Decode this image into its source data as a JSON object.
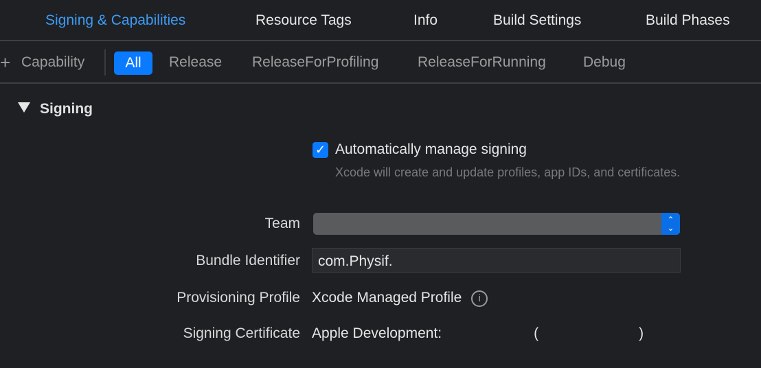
{
  "tabs": [
    "Signing & Capabilities",
    "Resource Tags",
    "Info",
    "Build Settings",
    "Build Phases"
  ],
  "filter": {
    "add_capability": "Capability",
    "configs": [
      "All",
      "Release",
      "ReleaseForProfiling",
      "ReleaseForRunning",
      "Debug"
    ]
  },
  "signing": {
    "title": "Signing",
    "auto_manage_label": "Automatically manage signing",
    "auto_manage_checked": true,
    "auto_manage_hint": "Xcode will create and update profiles, app IDs, and certificates.",
    "team_label": "Team",
    "team_value": "",
    "bundle_label": "Bundle Identifier",
    "bundle_value": "com.Physif.",
    "profile_label": "Provisioning Profile",
    "profile_value": "Xcode Managed Profile",
    "cert_label": "Signing Certificate",
    "cert_value": "Apple Development:",
    "cert_paren_open": "(",
    "cert_paren_close": ")"
  },
  "colors": {
    "accent": "#0a7aff",
    "active_tab": "#3d9bf5",
    "background": "#1e2023"
  }
}
